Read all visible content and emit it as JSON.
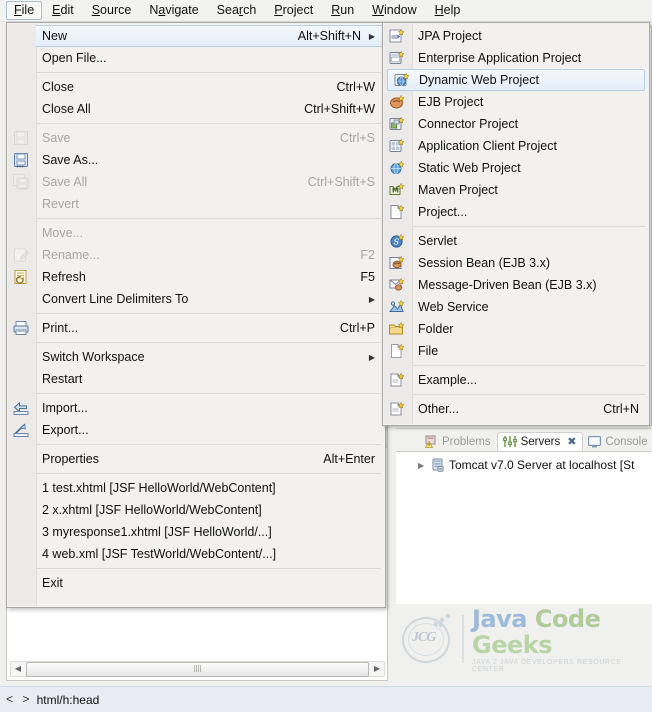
{
  "app": {
    "status_icon": "code-brackets-icon",
    "status_text": "html/h:head"
  },
  "menubar": {
    "items": [
      {
        "label": "File",
        "mnemonic": "F",
        "selected": true
      },
      {
        "label": "Edit",
        "mnemonic": "E",
        "selected": false
      },
      {
        "label": "Source",
        "mnemonic": "S",
        "selected": false
      },
      {
        "label": "Navigate",
        "mnemonic": "a",
        "selected": false
      },
      {
        "label": "Search",
        "mnemonic": "r",
        "selected": false
      },
      {
        "label": "Project",
        "mnemonic": "P",
        "selected": false
      },
      {
        "label": "Run",
        "mnemonic": "R",
        "selected": false
      },
      {
        "label": "Window",
        "mnemonic": "W",
        "selected": false
      },
      {
        "label": "Help",
        "mnemonic": "H",
        "selected": false
      }
    ]
  },
  "file_menu": {
    "groups": [
      {
        "items": [
          {
            "label": "New",
            "accel": "Alt+Shift+N",
            "submenu": true,
            "disabled": false,
            "highlight": true,
            "icon": ""
          },
          {
            "label": "Open File...",
            "accel": "",
            "submenu": false,
            "disabled": false,
            "highlight": false,
            "icon": ""
          }
        ]
      },
      {
        "items": [
          {
            "label": "Close",
            "accel": "Ctrl+W",
            "submenu": false,
            "disabled": false,
            "highlight": false,
            "icon": ""
          },
          {
            "label": "Close All",
            "accel": "Ctrl+Shift+W",
            "submenu": false,
            "disabled": false,
            "highlight": false,
            "icon": ""
          }
        ]
      },
      {
        "items": [
          {
            "label": "Save",
            "accel": "Ctrl+S",
            "submenu": false,
            "disabled": true,
            "highlight": false,
            "icon": "save-icon"
          },
          {
            "label": "Save As...",
            "accel": "",
            "submenu": false,
            "disabled": false,
            "highlight": false,
            "icon": "save-as-icon"
          },
          {
            "label": "Save All",
            "accel": "Ctrl+Shift+S",
            "submenu": false,
            "disabled": true,
            "highlight": false,
            "icon": "save-all-icon"
          },
          {
            "label": "Revert",
            "accel": "",
            "submenu": false,
            "disabled": true,
            "highlight": false,
            "icon": ""
          }
        ]
      },
      {
        "items": [
          {
            "label": "Move...",
            "accel": "",
            "submenu": false,
            "disabled": true,
            "highlight": false,
            "icon": ""
          },
          {
            "label": "Rename...",
            "accel": "F2",
            "submenu": false,
            "disabled": true,
            "highlight": false,
            "icon": "rename-icon"
          },
          {
            "label": "Refresh",
            "accel": "F5",
            "submenu": false,
            "disabled": false,
            "highlight": false,
            "icon": "refresh-icon"
          },
          {
            "label": "Convert Line Delimiters To",
            "accel": "",
            "submenu": true,
            "disabled": false,
            "highlight": false,
            "icon": ""
          }
        ]
      },
      {
        "items": [
          {
            "label": "Print...",
            "accel": "Ctrl+P",
            "submenu": false,
            "disabled": false,
            "highlight": false,
            "icon": "print-icon"
          }
        ]
      },
      {
        "items": [
          {
            "label": "Switch Workspace",
            "accel": "",
            "submenu": true,
            "disabled": false,
            "highlight": false,
            "icon": ""
          },
          {
            "label": "Restart",
            "accel": "",
            "submenu": false,
            "disabled": false,
            "highlight": false,
            "icon": ""
          }
        ]
      },
      {
        "items": [
          {
            "label": "Import...",
            "accel": "",
            "submenu": false,
            "disabled": false,
            "highlight": false,
            "icon": "import-icon"
          },
          {
            "label": "Export...",
            "accel": "",
            "submenu": false,
            "disabled": false,
            "highlight": false,
            "icon": "export-icon"
          }
        ]
      },
      {
        "items": [
          {
            "label": "Properties",
            "accel": "Alt+Enter",
            "submenu": false,
            "disabled": false,
            "highlight": false,
            "icon": ""
          }
        ]
      },
      {
        "items": [
          {
            "label": "1 test.xhtml  [JSF HelloWorld/WebContent]",
            "accel": "",
            "submenu": false,
            "disabled": false,
            "highlight": false,
            "icon": ""
          },
          {
            "label": "2 x.xhtml  [JSF HelloWorld/WebContent]",
            "accel": "",
            "submenu": false,
            "disabled": false,
            "highlight": false,
            "icon": ""
          },
          {
            "label": "3 myresponse1.xhtml  [JSF HelloWorld/...]",
            "accel": "",
            "submenu": false,
            "disabled": false,
            "highlight": false,
            "icon": ""
          },
          {
            "label": "4 web.xml  [JSF TestWorld/WebContent/...]",
            "accel": "",
            "submenu": false,
            "disabled": false,
            "highlight": false,
            "icon": ""
          }
        ]
      },
      {
        "items": [
          {
            "label": "Exit",
            "accel": "",
            "submenu": false,
            "disabled": false,
            "highlight": false,
            "icon": ""
          }
        ]
      }
    ]
  },
  "new_submenu": {
    "groups": [
      {
        "items": [
          {
            "label": "JPA Project",
            "accel": "",
            "highlight": false,
            "icon": "jpa-project-icon"
          },
          {
            "label": "Enterprise Application Project",
            "accel": "",
            "highlight": false,
            "icon": "enterprise-app-project-icon"
          },
          {
            "label": "Dynamic Web Project",
            "accel": "",
            "highlight": true,
            "icon": "dynamic-web-project-icon"
          },
          {
            "label": "EJB Project",
            "accel": "",
            "highlight": false,
            "icon": "ejb-project-icon"
          },
          {
            "label": "Connector Project",
            "accel": "",
            "highlight": false,
            "icon": "connector-project-icon"
          },
          {
            "label": "Application Client Project",
            "accel": "",
            "highlight": false,
            "icon": "app-client-project-icon"
          },
          {
            "label": "Static Web Project",
            "accel": "",
            "highlight": false,
            "icon": "static-web-project-icon"
          },
          {
            "label": "Maven Project",
            "accel": "",
            "highlight": false,
            "icon": "maven-project-icon"
          },
          {
            "label": "Project...",
            "accel": "",
            "highlight": false,
            "icon": "project-icon"
          }
        ]
      },
      {
        "items": [
          {
            "label": "Servlet",
            "accel": "",
            "highlight": false,
            "icon": "servlet-icon"
          },
          {
            "label": "Session Bean (EJB 3.x)",
            "accel": "",
            "highlight": false,
            "icon": "session-bean-icon"
          },
          {
            "label": "Message-Driven Bean (EJB 3.x)",
            "accel": "",
            "highlight": false,
            "icon": "message-driven-bean-icon"
          },
          {
            "label": "Web Service",
            "accel": "",
            "highlight": false,
            "icon": "web-service-icon"
          },
          {
            "label": "Folder",
            "accel": "",
            "highlight": false,
            "icon": "folder-icon"
          },
          {
            "label": "File",
            "accel": "",
            "highlight": false,
            "icon": "file-icon"
          }
        ]
      },
      {
        "items": [
          {
            "label": "Example...",
            "accel": "",
            "highlight": false,
            "icon": "example-icon"
          }
        ]
      },
      {
        "items": [
          {
            "label": "Other...",
            "accel": "Ctrl+N",
            "highlight": false,
            "icon": "other-icon"
          }
        ]
      }
    ]
  },
  "views": {
    "tabs": [
      {
        "label": "Problems",
        "active": false,
        "icon": "problems-icon"
      },
      {
        "label": "Servers",
        "active": true,
        "icon": "servers-icon"
      },
      {
        "label": "Console",
        "active": false,
        "icon": "console-icon"
      }
    ],
    "close_icon": "close-icon",
    "server_row": {
      "label": "Tomcat v7.0 Server at localhost  [St",
      "icon": "server-icon",
      "expand_icon": "chevron-right-icon"
    }
  },
  "watermark": {
    "logo_text": "JCG",
    "title_part1": "Java",
    "title_part2": "Code",
    "title_part3": "Geeks",
    "subtitle": "JAVA 2 JAVA DEVELOPERS RESOURCE CENTER"
  },
  "colors": {
    "menu_bg": "#f2f1f0",
    "highlight_border": "#b9cfe4",
    "highlight_fill": "#e4eef9",
    "disabled_text": "#a6a6a3",
    "status_bg": "#e8ecf4"
  }
}
